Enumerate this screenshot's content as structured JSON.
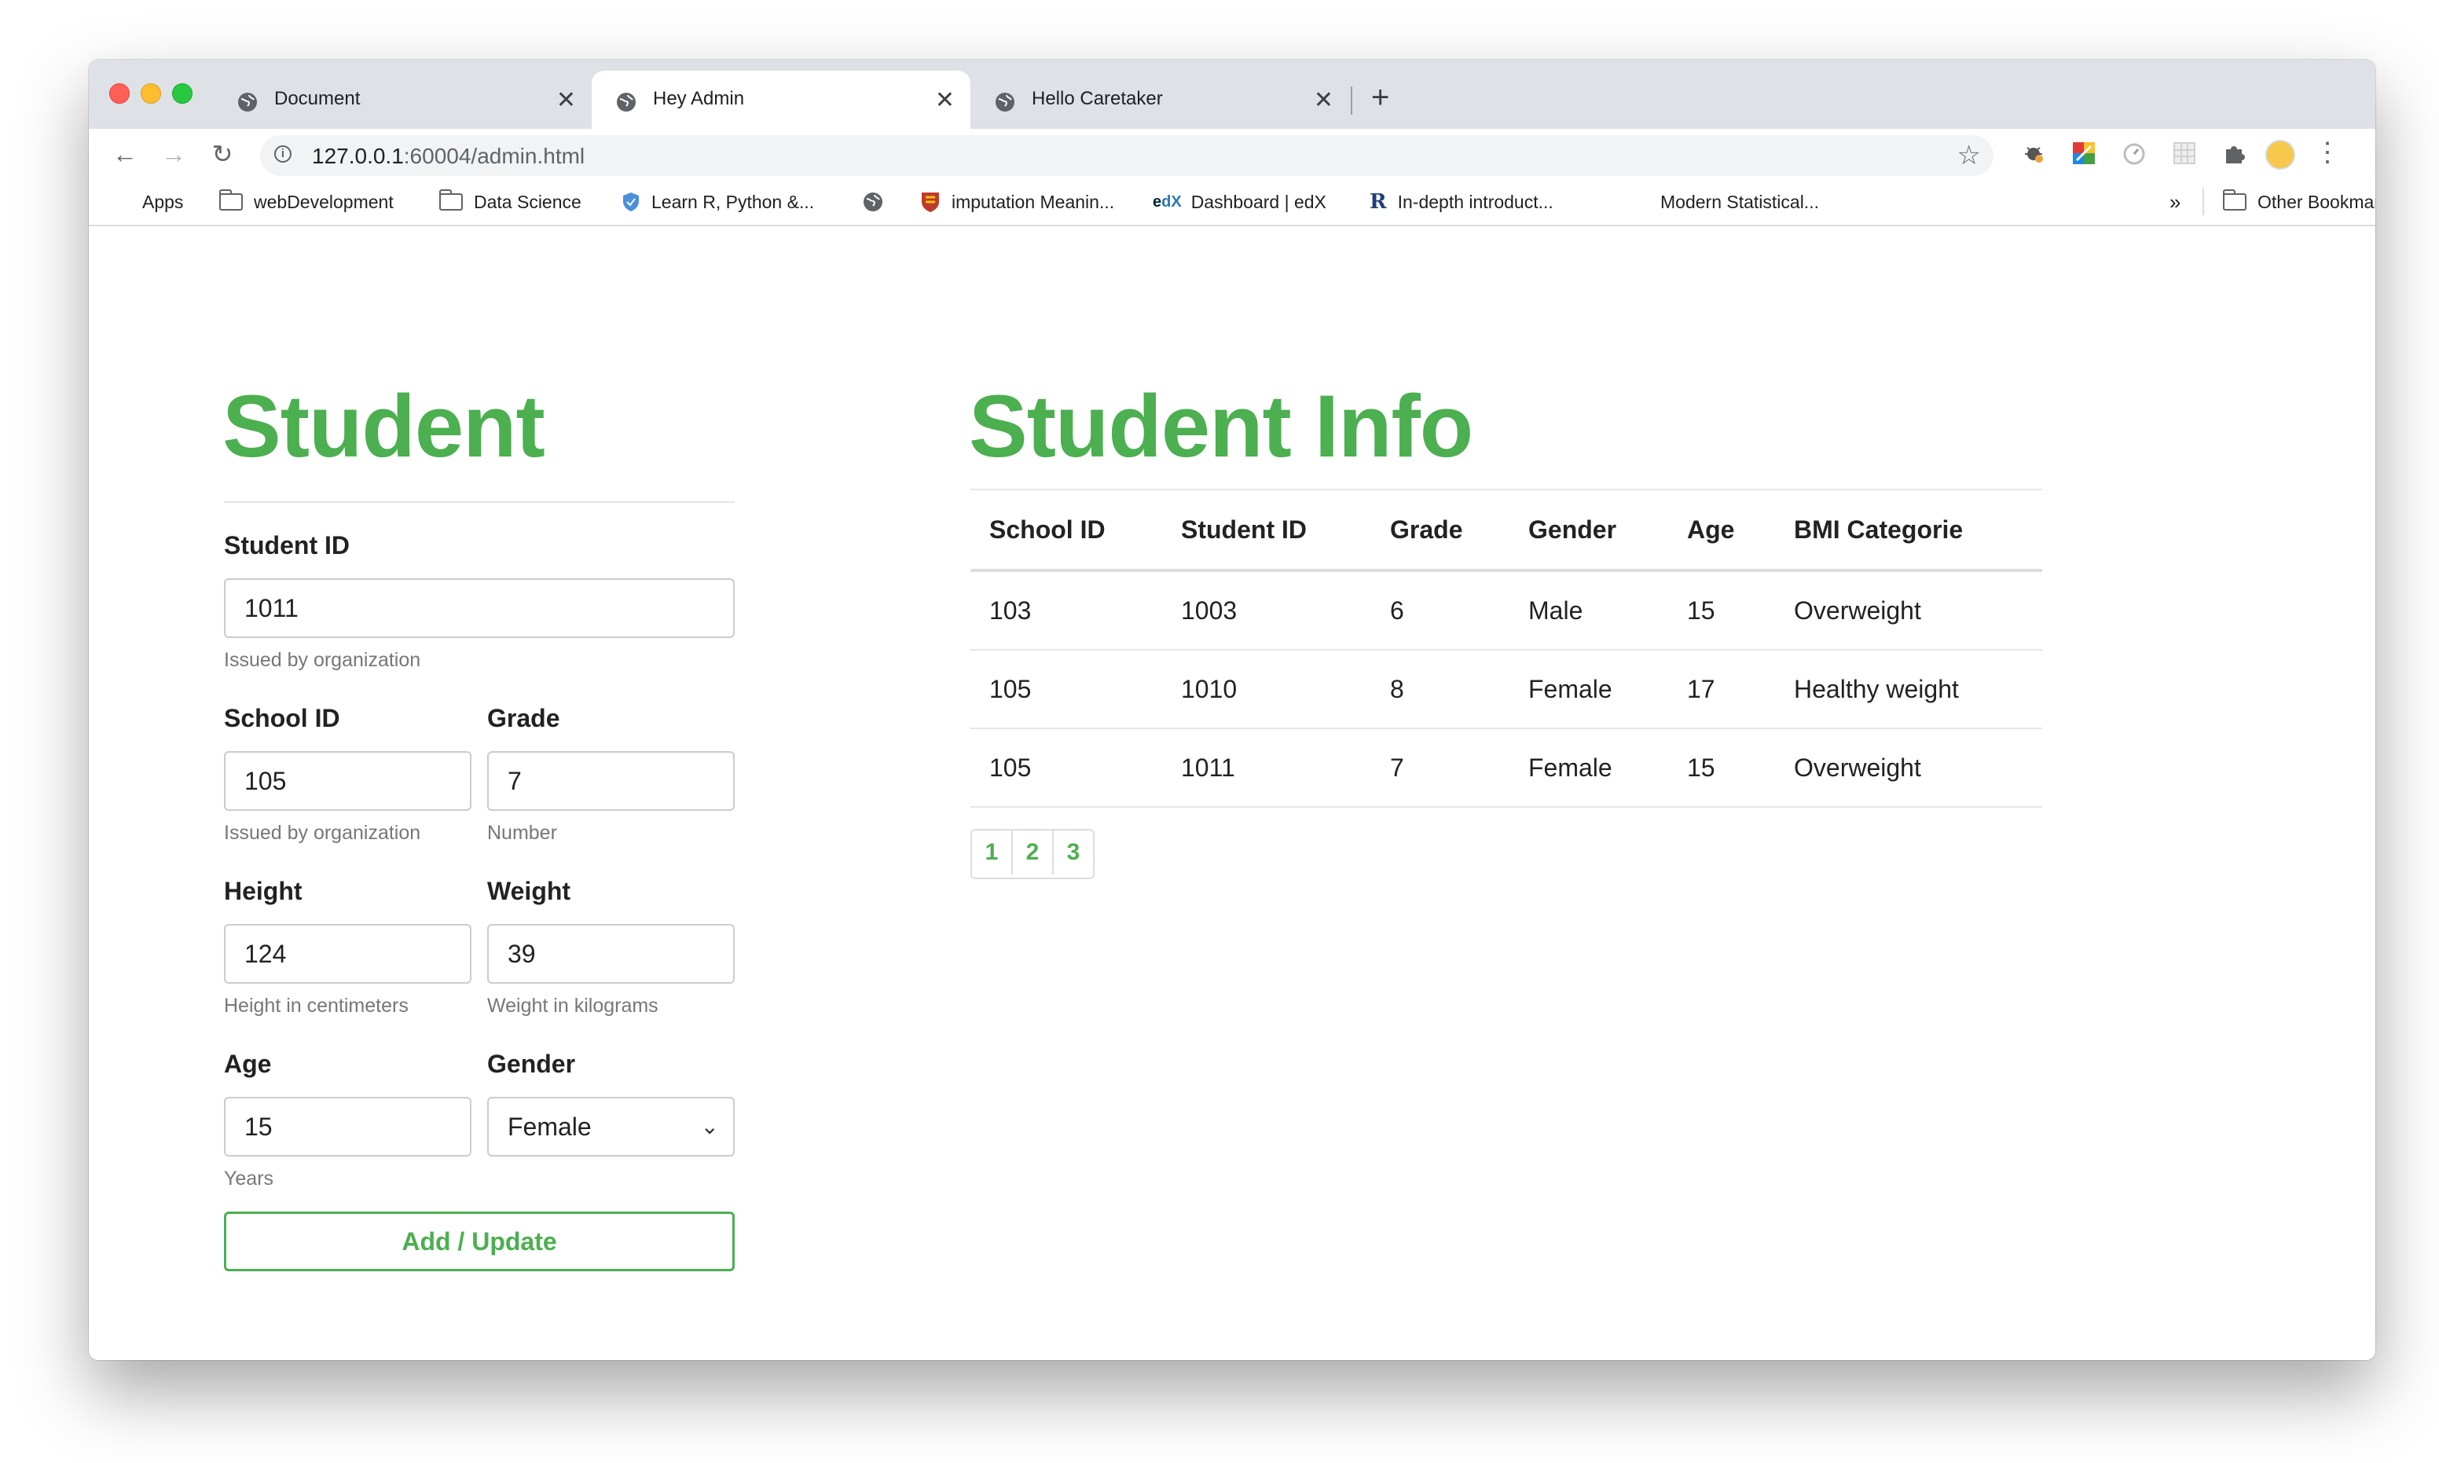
{
  "browser": {
    "tabs": [
      {
        "title": "Document",
        "active": false
      },
      {
        "title": "Hey Admin",
        "active": true
      },
      {
        "title": "Hello Caretaker",
        "active": false
      }
    ],
    "url_host": "127.0.0.1",
    "url_rest": ":60004/admin.html",
    "bookmarks": [
      {
        "label": "Apps",
        "icon": "apps-grid-icon"
      },
      {
        "label": "webDevelopment",
        "icon": "folder-icon"
      },
      {
        "label": "Data Science",
        "icon": "folder-icon"
      },
      {
        "label": "Learn R, Python &...",
        "icon": "shield-icon"
      },
      {
        "label": "",
        "icon": "globe-icon"
      },
      {
        "label": "imputation Meanin...",
        "icon": "crest-icon"
      },
      {
        "label": "Dashboard | edX",
        "icon": "edx-icon"
      },
      {
        "label": "In-depth introduct...",
        "icon": "r-logo-icon"
      },
      {
        "label": "Modern Statistical...",
        "icon": ""
      }
    ],
    "overflow_chevron": "»",
    "other_bookmarks": "Other Bookmarks"
  },
  "form": {
    "title": "Student",
    "student_id": {
      "label": "Student ID",
      "value": "1011",
      "hint": "Issued by organization"
    },
    "school_id": {
      "label": "School ID",
      "value": "105",
      "hint": "Issued by organization"
    },
    "grade": {
      "label": "Grade",
      "value": "7",
      "hint": "Number"
    },
    "height": {
      "label": "Height",
      "value": "124",
      "hint": "Height in centimeters"
    },
    "weight": {
      "label": "Weight",
      "value": "39",
      "hint": "Weight in kilograms"
    },
    "age": {
      "label": "Age",
      "value": "15",
      "hint": "Years"
    },
    "gender": {
      "label": "Gender",
      "value": "Female"
    },
    "submit_label": "Add / Update"
  },
  "info": {
    "title": "Student Info",
    "columns": [
      "School ID",
      "Student ID",
      "Grade",
      "Gender",
      "Age",
      "BMI Categorie"
    ],
    "rows": [
      [
        "103",
        "1003",
        "6",
        "Male",
        "15",
        "Overweight"
      ],
      [
        "105",
        "1010",
        "8",
        "Female",
        "17",
        "Healthy weight"
      ],
      [
        "105",
        "1011",
        "7",
        "Female",
        "15",
        "Overweight"
      ]
    ],
    "pages": [
      "1",
      "2",
      "3"
    ]
  },
  "colors": {
    "accent": "#4caf50"
  }
}
